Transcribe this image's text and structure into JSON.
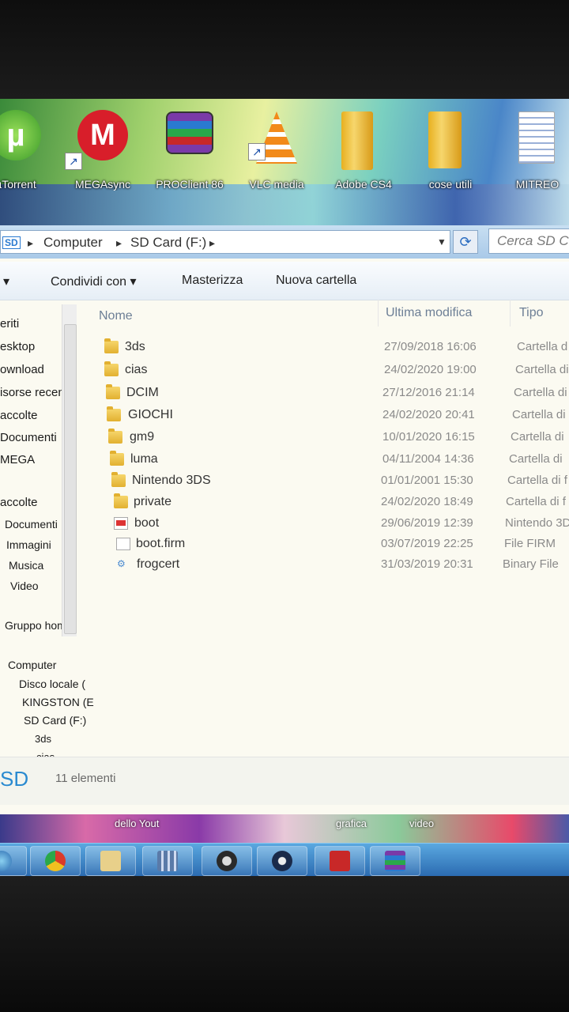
{
  "desktop_icons": [
    {
      "label": "µTorrent",
      "icon": "utorrent-icon"
    },
    {
      "label": "MEGAsync",
      "icon": "mega-icon"
    },
    {
      "label": "PROClient 86",
      "icon": "winrar-icon"
    },
    {
      "label": "VLC media",
      "icon": "vlc-icon"
    },
    {
      "label": "Adobe CS4",
      "icon": "folder-icon"
    },
    {
      "label": "cose utili",
      "icon": "folder-icon"
    },
    {
      "label": "MITREO",
      "icon": "document-icon"
    }
  ],
  "address": {
    "crumbs": [
      "Computer",
      "SD Card (F:)"
    ],
    "separator": "▸",
    "refresh_icon": "refresh-icon"
  },
  "search": {
    "placeholder": "Cerca SD Card"
  },
  "toolbar": {
    "first_arrow": "▾",
    "share": "Condividi con",
    "burn": "Masterizza",
    "new_folder": "Nuova cartella"
  },
  "nav": {
    "favorites": [
      "eriti",
      "esktop",
      "ownload",
      "isorse recen",
      "accolte",
      "Documenti",
      "MEGA"
    ],
    "libraries": [
      "accolte",
      "Documenti",
      "Immagini",
      "Musica",
      "Video"
    ],
    "homegroup": "Gruppo home",
    "computer": "Computer",
    "drives": [
      "Disco locale (",
      "KINGSTON (E",
      "SD Card (F:)",
      "3ds",
      "cias"
    ]
  },
  "columns": {
    "name": "Nome",
    "modified": "Ultima modifica",
    "type": "Tipo"
  },
  "files": [
    {
      "name": "3ds",
      "modified": "27/09/2018 16:06",
      "type": "Cartella d",
      "kind": "folder"
    },
    {
      "name": "cias",
      "modified": "24/02/2020 19:00",
      "type": "Cartella di",
      "kind": "folder"
    },
    {
      "name": "DCIM",
      "modified": "27/12/2016 21:14",
      "type": "Cartella di",
      "kind": "folder"
    },
    {
      "name": "GIOCHI",
      "modified": "24/02/2020 20:41",
      "type": "Cartella di",
      "kind": "folder"
    },
    {
      "name": "gm9",
      "modified": "10/01/2020 16:15",
      "type": "Cartella di",
      "kind": "folder"
    },
    {
      "name": "luma",
      "modified": "04/11/2004 14:36",
      "type": "Cartella di",
      "kind": "folder"
    },
    {
      "name": "Nintendo 3DS",
      "modified": "01/01/2001 15:30",
      "type": "Cartella di f",
      "kind": "folder"
    },
    {
      "name": "private",
      "modified": "24/02/2020 18:49",
      "type": "Cartella di f",
      "kind": "folder"
    },
    {
      "name": "boot",
      "modified": "29/06/2019 12:39",
      "type": "Nintendo 3D",
      "kind": "boot"
    },
    {
      "name": "boot.firm",
      "modified": "03/07/2019 22:25",
      "type": "File FIRM",
      "kind": "file"
    },
    {
      "name": "frogcert",
      "modified": "31/03/2019 20:31",
      "type": "Binary File",
      "kind": "file"
    }
  ],
  "status": {
    "drive_label": "SD",
    "count": "11 elementi"
  },
  "wallpaper_strip": {
    "text1": "dello Yout",
    "text2": "grafica",
    "text3": "video"
  },
  "taskbar": [
    {
      "icon": "start-orb-icon",
      "color": "#3a86d0"
    },
    {
      "icon": "chrome-icon",
      "color": "#e0a020"
    },
    {
      "icon": "explorer-folder-icon",
      "color": "#e8d08a"
    },
    {
      "icon": "film-icon",
      "color": "#5a7aa8"
    },
    {
      "icon": "obs-icon",
      "color": "#2a2a2a"
    },
    {
      "icon": "steam-icon",
      "color": "#1a2a4a"
    },
    {
      "icon": "mcafee-icon",
      "color": "#c82828"
    },
    {
      "icon": "winrar-icon",
      "color": "#7a3aa8"
    }
  ]
}
